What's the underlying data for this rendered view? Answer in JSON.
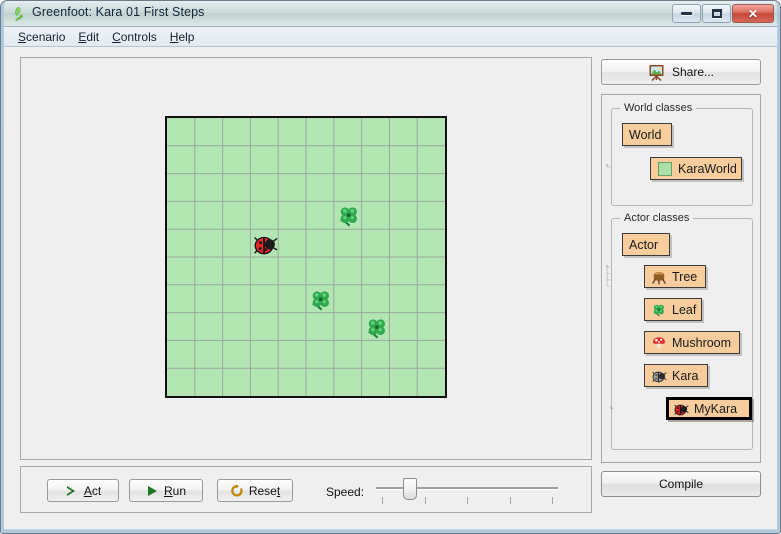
{
  "window": {
    "title": "Greenfoot: Kara 01 First Steps",
    "icon": "greenfoot-footprint-icon",
    "controls": {
      "minimize": "minimize-icon",
      "maximize": "maximize-icon",
      "close": "✕"
    }
  },
  "menubar": {
    "items": [
      {
        "label": "Scenario",
        "mnemonic": "S"
      },
      {
        "label": "Edit",
        "mnemonic": "E"
      },
      {
        "label": "Controls",
        "mnemonic": "C"
      },
      {
        "label": "Help",
        "mnemonic": "H"
      }
    ]
  },
  "controls": {
    "act_label": "Act",
    "act_mnemonic": "A",
    "run_label": "Run",
    "run_mnemonic": "R",
    "reset_label": "Reset",
    "reset_mnemonic": "t",
    "speed_label": "Speed:",
    "speed_value": 16,
    "tick_count": 5
  },
  "sidebar": {
    "share_label": "Share...",
    "share_icon": "share-easel-icon",
    "compile_label": "Compile",
    "world_group": {
      "title": "World classes",
      "classes": [
        {
          "name": "World",
          "icon": "none",
          "selected": false
        },
        {
          "name": "KaraWorld",
          "icon": "green-square-icon",
          "selected": false
        }
      ]
    },
    "actor_group": {
      "title": "Actor classes",
      "classes": [
        {
          "name": "Actor",
          "icon": "none",
          "selected": false
        },
        {
          "name": "Tree",
          "icon": "tree-stump-icon",
          "selected": false
        },
        {
          "name": "Leaf",
          "icon": "clover-leaf-icon",
          "selected": false
        },
        {
          "name": "Mushroom",
          "icon": "mushroom-icon",
          "selected": false
        },
        {
          "name": "Kara",
          "icon": "gray-bug-icon",
          "selected": false
        },
        {
          "name": "MyKara",
          "icon": "red-ladybug-icon",
          "selected": true
        }
      ]
    }
  },
  "world": {
    "grid_cols": 10,
    "grid_rows": 10,
    "cell_size": 28,
    "background_color": "#b2e5b2",
    "grid_line_color": "#9aa79a",
    "border_color": "#111111",
    "actors": [
      {
        "type": "kara",
        "icon": "red-ladybug-icon",
        "col": 3,
        "row": 4
      },
      {
        "type": "leaf",
        "icon": "clover-leaf-icon",
        "col": 6,
        "row": 3
      },
      {
        "type": "leaf",
        "icon": "clover-leaf-icon",
        "col": 5,
        "row": 6
      },
      {
        "type": "leaf",
        "icon": "clover-leaf-icon",
        "col": 7,
        "row": 7
      }
    ]
  },
  "colors": {
    "class_box": "#f7cd9e",
    "world_green": "#b2e5b2",
    "panel_bg": "#efeff0",
    "selection_border": "#000000"
  }
}
